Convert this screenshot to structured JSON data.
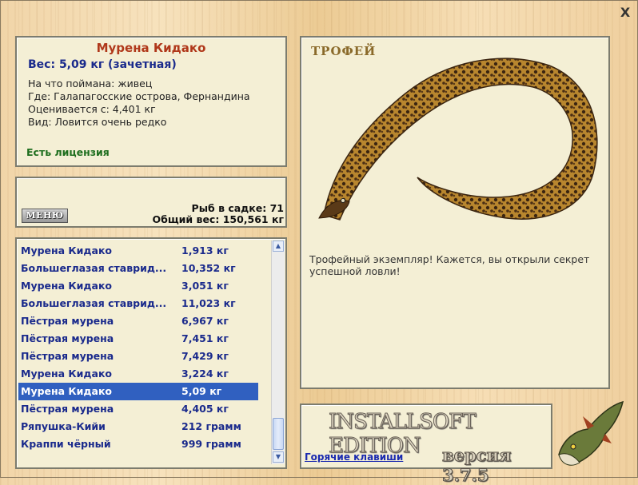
{
  "window": {
    "close_glyph": "X"
  },
  "info": {
    "fish_name": "Мурена Кидако",
    "weight_line": "Вес: 5,09 кг (зачетная)",
    "caught_on": "На что поймана: живец",
    "location": "Где: Галапагосские острова, Фернандина",
    "valued_from": "Оценивается с: 4,401 кг",
    "rarity": "Вид: Ловится очень редко",
    "license": "Есть лицензия"
  },
  "stats": {
    "menu_label": "МЕНЮ",
    "fish_in_keepnet": "Рыб в садке: 71",
    "total_weight": "Общий вес: 150,561 кг"
  },
  "catch_list": [
    {
      "name": "Мурена Кидако",
      "weight": "1,913 кг"
    },
    {
      "name": "Большеглазая ставрид...",
      "weight": "10,352 кг"
    },
    {
      "name": "Мурена Кидако",
      "weight": "3,051 кг"
    },
    {
      "name": "Большеглазая ставрид...",
      "weight": "11,023 кг"
    },
    {
      "name": "Пёстрая мурена",
      "weight": "6,967 кг"
    },
    {
      "name": "Пёстрая мурена",
      "weight": "7,451 кг"
    },
    {
      "name": "Пёстрая мурена",
      "weight": "7,429 кг"
    },
    {
      "name": "Мурена Кидако",
      "weight": "3,224 кг"
    },
    {
      "name": "Мурена Кидако",
      "weight": "5,09 кг",
      "selected": true
    },
    {
      "name": "Пёстрая мурена",
      "weight": "4,405 кг"
    },
    {
      "name": "Ряпушка-Кийи",
      "weight": "212 грамм"
    },
    {
      "name": "Краппи чёрный",
      "weight": "999 грамм"
    }
  ],
  "trophy": {
    "label": "ТРОФЕЙ",
    "description": "Трофейный экземпляр! Кажется, вы открыли секрет успешной ловли!"
  },
  "version_panel": {
    "brand": "INSTALLSOFT EDITION",
    "hotkeys_link": "Горячие клавиши",
    "version": "версия 3.7.5"
  },
  "icons": [
    "close-icon",
    "scroll-up-icon",
    "scroll-down-icon",
    "moray-eel-image",
    "pike-logo"
  ],
  "colors": {
    "selected_row": "#3060c0",
    "fish_name": "#b0381a",
    "list_text": "#1a2a8c",
    "license": "#1e6e1e"
  }
}
